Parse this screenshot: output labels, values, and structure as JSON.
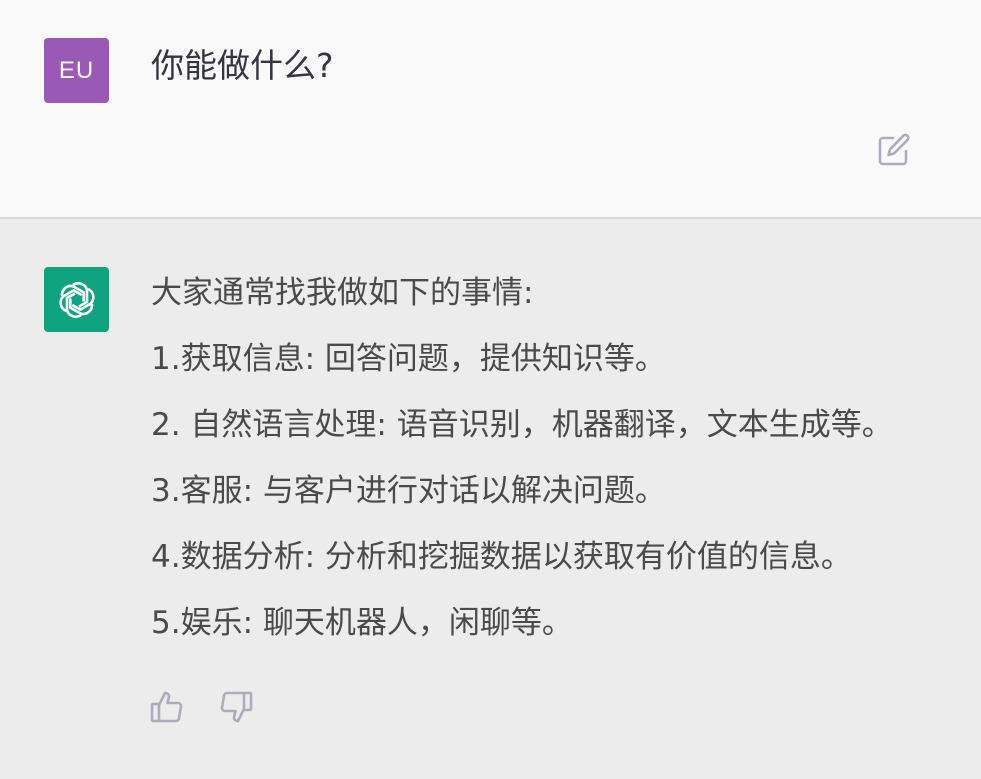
{
  "user_message": {
    "avatar_initials": "EU",
    "avatar_color": "#9b59b6",
    "text": "你能做什么?"
  },
  "assistant_message": {
    "avatar_icon": "openai-logo-icon",
    "avatar_color": "#10a37f",
    "lines": [
      "大家通常找我做如下的事情:",
      "1.获取信息: 回答问题，提供知识等。",
      "2. 自然语言处理: 语音识别，机器翻译，文本生成等。",
      "3.客服: 与客户进行对话以解决问题。",
      "4.数据分析: 分析和挖掘数据以获取有价值的信息。",
      "5.娱乐: 聊天机器人，闲聊等。"
    ]
  },
  "icons": {
    "edit": "edit-icon",
    "thumbs_up": "thumbs-up-icon",
    "thumbs_down": "thumbs-down-icon"
  }
}
